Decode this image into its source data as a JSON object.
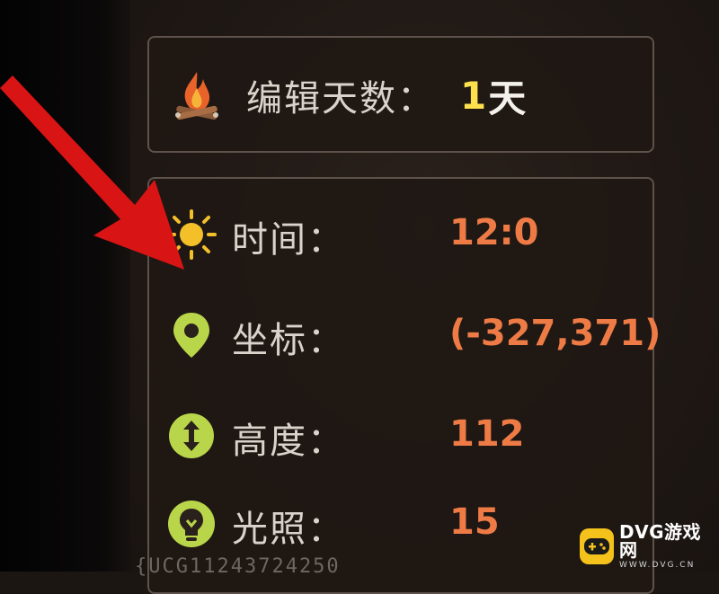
{
  "day": {
    "label": "编辑天数：",
    "value": "1",
    "unit": "天",
    "icon": "campfire-icon"
  },
  "stats": [
    {
      "label": "时间：",
      "value": "12:0",
      "icon": "sun-icon"
    },
    {
      "label": "坐标：",
      "value": "(-327,371)",
      "icon": "location-pin-icon"
    },
    {
      "label": "高度：",
      "value": "112",
      "icon": "height-arrows-icon"
    },
    {
      "label": "光照：",
      "value": "15",
      "icon": "lightbulb-icon"
    }
  ],
  "watermark": {
    "main": "DVG游戏网",
    "sub": "WWW.DVG.CN"
  },
  "bottom_text": "{UCG11243724250",
  "colors": {
    "value": "#ee7b45",
    "day_number": "#ffe14d",
    "label": "#d9d3cb",
    "border": "#5e524a",
    "arrow": "#d81414",
    "icon_green": "#b9d64a",
    "sun": "#f3c02a"
  }
}
